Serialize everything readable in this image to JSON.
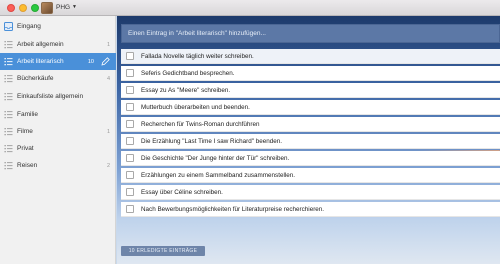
{
  "titlebar": {
    "user_name": "PHG"
  },
  "sidebar": {
    "items": [
      {
        "label": "Eingang",
        "count": "",
        "icon": "inbox-icon"
      },
      {
        "label": "Arbeit allgemein",
        "count": "1",
        "icon": "list-icon"
      },
      {
        "label": "Arbeit literarisch",
        "count": "10",
        "icon": "list-icon",
        "active": true
      },
      {
        "label": "Bücherkäufe",
        "count": "4",
        "icon": "list-icon"
      },
      {
        "label": "Einkaufsliste allgemein",
        "count": "",
        "icon": "list-icon"
      },
      {
        "label": "Familie",
        "count": "",
        "icon": "list-icon"
      },
      {
        "label": "Filme",
        "count": "1",
        "icon": "list-icon"
      },
      {
        "label": "Privat",
        "count": "",
        "icon": "list-icon"
      },
      {
        "label": "Reisen",
        "count": "2",
        "icon": "list-icon"
      }
    ]
  },
  "main": {
    "add_placeholder": "Einen Eintrag in \"Arbeit literarisch\" hinzufügen...",
    "tasks": [
      "Fallada Novelle täglich weiter schreiben.",
      "Seferis Gedichtband besprechen.",
      "Essay zu As \"Meere\" schreiben.",
      "Mutterbuch überarbeiten und beenden.",
      "Recherchen für Twins-Roman durchführen",
      "Die Erzählung \"Last Time I saw Richard\" beenden.",
      "Die Geschichte \"Der Junge hinter der Tür\" schreiben.",
      "Erzählungen zu einem Sammelband zusammenstellen.",
      "Essay über Céline schreiben.",
      "Nach Bewerbungsmöglichkeiten für Literaturpreise recherchieren."
    ],
    "completed_label": "10 ERLEDIGTE EINTRÄGE"
  },
  "colors": {
    "accent": "#4a90d9",
    "sidebar_bg": "#f1f1f1"
  }
}
